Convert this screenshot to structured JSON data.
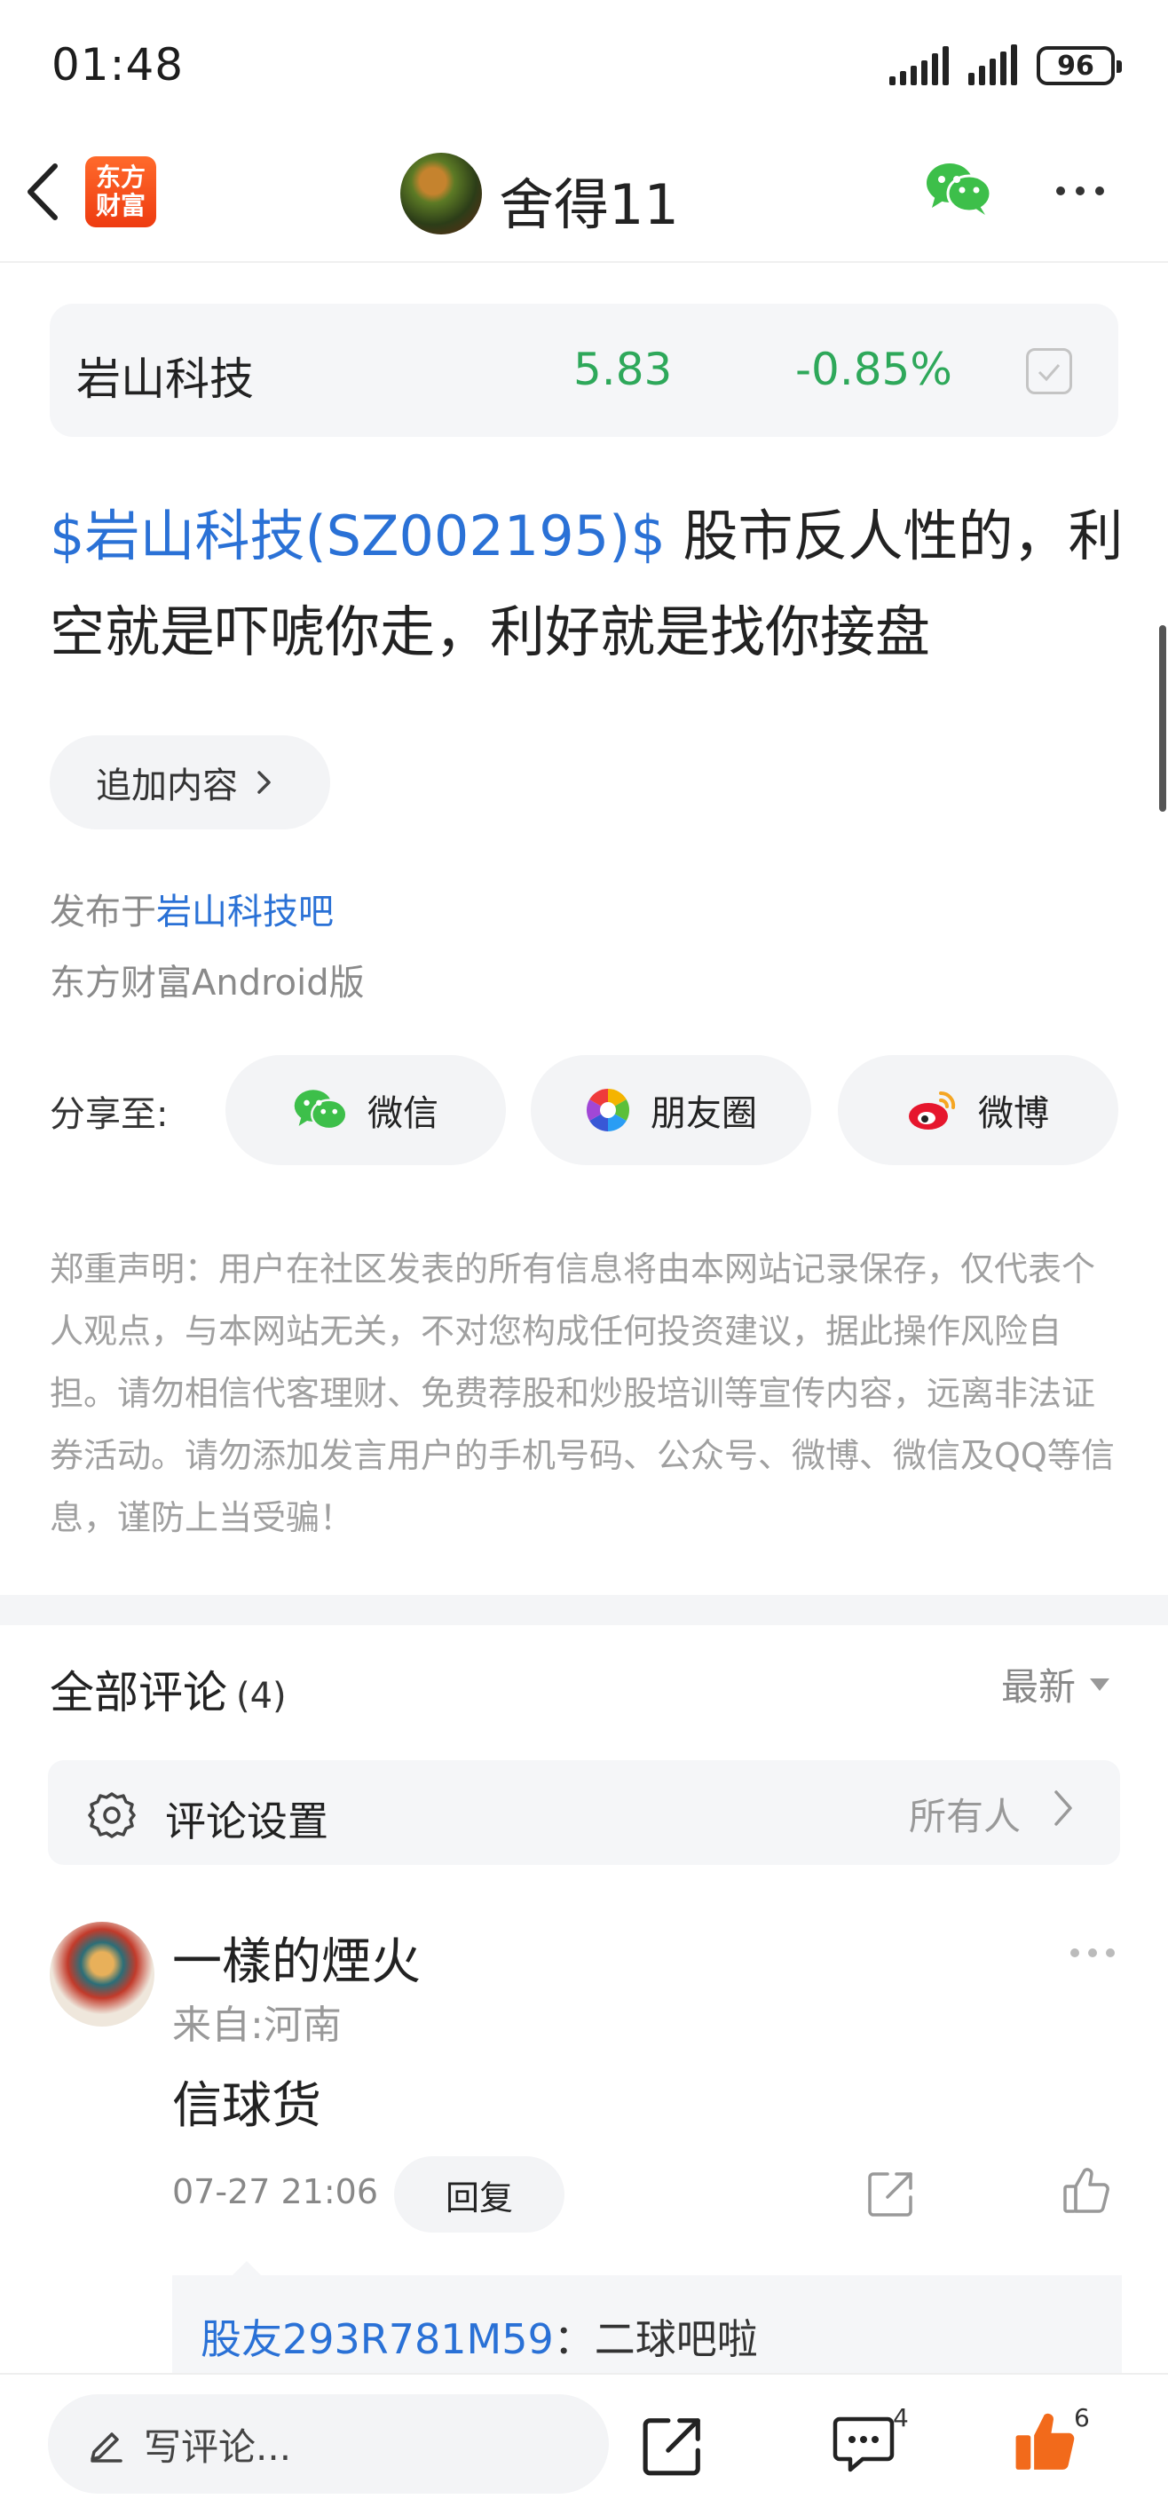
{
  "status_bar": {
    "time": "01:48",
    "battery": "96"
  },
  "nav": {
    "app_logo_text": "东方财富",
    "author_name": "舍得11"
  },
  "stock": {
    "name": "岩山科技",
    "price": "5.83",
    "change": "-0.85%",
    "change_color": "#2ea85a"
  },
  "post": {
    "stock_tag": "$岩山科技(SZ002195)$",
    "text": " 股市反人性的，利空就是吓唬你走，利好就是找你接盘",
    "append_label": "追加内容",
    "published_prefix": "发布于",
    "published_bar": "岩山科技吧",
    "client": "东方财富Android版"
  },
  "share": {
    "label": "分享至:",
    "targets": [
      {
        "label": "微信",
        "icon": "wechat-icon"
      },
      {
        "label": "朋友圈",
        "icon": "moments-icon"
      },
      {
        "label": "微博",
        "icon": "weibo-icon"
      }
    ]
  },
  "disclaimer": "郑重声明：用户在社区发表的所有信息将由本网站记录保存，仅代表个人观点，与本网站无关，不对您构成任何投资建议，据此操作风险自担。请勿相信代客理财、免费荐股和炒股培训等宣传内容，远离非法证券活动。请勿添加发言用户的手机号码、公众号、微博、微信及QQ等信息，谨防上当受骗！",
  "comments": {
    "title": "全部评论",
    "count": "(4)",
    "sort": "最新",
    "settings_label": "评论设置",
    "settings_value": "所有人",
    "items": [
      {
        "name": "一樣的煙火",
        "location": "来自:河南",
        "body": "信球货",
        "time": "07-27 21:06",
        "reply_label": "回复",
        "replies": [
          {
            "user": "股友293R781M59",
            "text": "：二球吧啦"
          }
        ]
      }
    ]
  },
  "bottom_bar": {
    "write_placeholder": "写评论...",
    "comment_count": "4",
    "like_count": "6",
    "like_color": "#f26a1b"
  },
  "colors": {
    "link": "#2a71d6",
    "down": "#2ea85a",
    "accent": "#f26a1b"
  }
}
